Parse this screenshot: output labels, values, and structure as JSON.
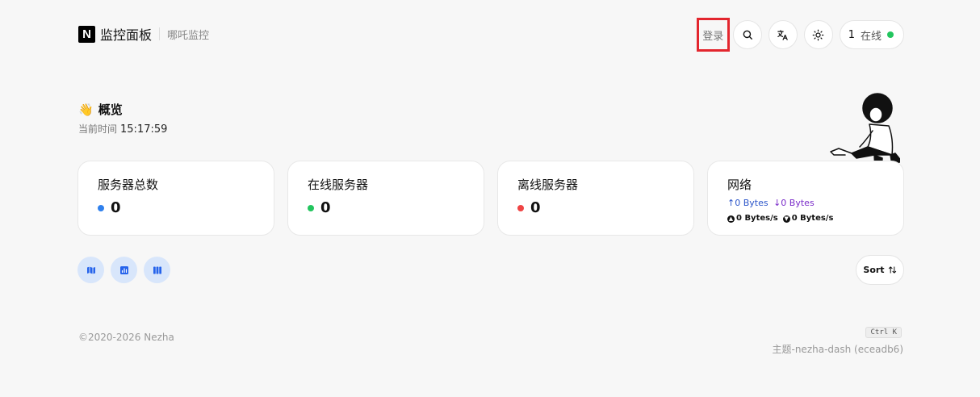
{
  "header": {
    "logo_letter": "N",
    "title": "监控面板",
    "subtitle": "哪吒监控",
    "login_label": "登录",
    "online_count": "1",
    "online_label": "在线",
    "icons": [
      "search-icon",
      "translate-icon",
      "sun-icon"
    ]
  },
  "overview": {
    "emoji": "👋",
    "title": "概览",
    "time_label": "当前时间",
    "time_value": "15:17:59"
  },
  "cards": [
    {
      "title": "服务器总数",
      "value": "0",
      "dot_color": "#2f80ed"
    },
    {
      "title": "在线服务器",
      "value": "0",
      "dot_color": "#22c55e"
    },
    {
      "title": "离线服务器",
      "value": "0",
      "dot_color": "#ef4444"
    }
  ],
  "network": {
    "title": "网络",
    "upload": "↑0 Bytes",
    "download": "↓0 Bytes",
    "upload_speed": "0 Bytes/s",
    "download_speed": "0 Bytes/s"
  },
  "views": [
    "map-icon",
    "chart-icon",
    "grid-icon"
  ],
  "sort": {
    "label": "Sort"
  },
  "footer": {
    "copyright": "©2020-2026 Nezha",
    "shortcut": "Ctrl K",
    "theme": "主题-nezha-dash (eceadb6)"
  },
  "colors": {
    "accent": "#2563eb",
    "view_bg": "#d8e6fb",
    "highlight": "#e3262e"
  }
}
